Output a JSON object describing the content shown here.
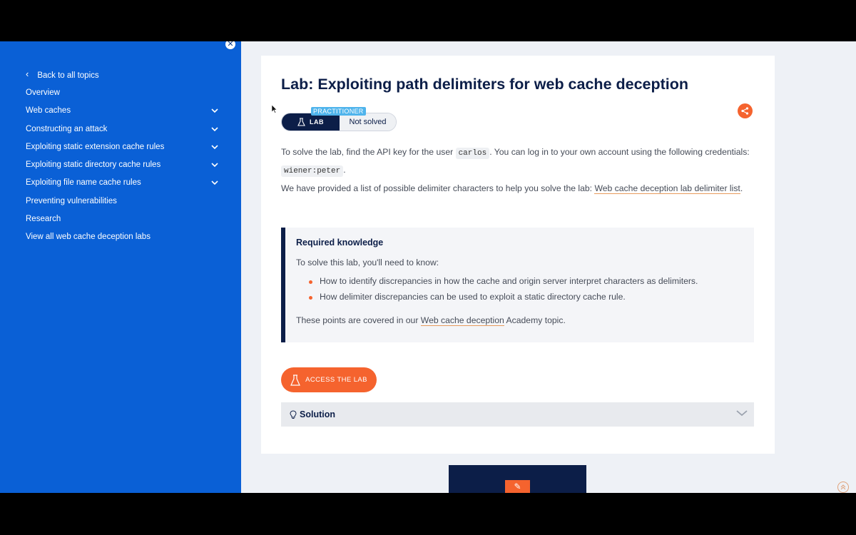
{
  "sidebar": {
    "close_icon": "close-icon",
    "back_label": "Back to all topics",
    "items": [
      {
        "label": "Overview",
        "expandable": false
      },
      {
        "label": "Web caches",
        "expandable": true
      },
      {
        "label": "Constructing an attack",
        "expandable": true
      },
      {
        "label": "Exploiting static extension cache rules",
        "expandable": true
      },
      {
        "label": "Exploiting static directory cache rules",
        "expandable": true
      },
      {
        "label": "Exploiting file name cache rules",
        "expandable": true
      },
      {
        "label": "Preventing vulnerabilities",
        "expandable": false
      },
      {
        "label": "Research",
        "expandable": false
      },
      {
        "label": "View all web cache deception labs",
        "expandable": false
      }
    ]
  },
  "lab": {
    "title": "Lab: Exploiting path delimiters for web cache deception",
    "level": "PRACTITIONER",
    "badge_label": "LAB",
    "status": "Not solved",
    "p1_a": "To solve the lab, find the API key for the user ",
    "p1_code1": "carlos",
    "p1_b": ". You can log in to your own account using the following credentials: ",
    "p1_code2": "wiener:peter",
    "p1_c": ".",
    "p2_a": "We have provided a list of possible delimiter characters to help you solve the lab: ",
    "p2_link": "Web cache deception lab delimiter list",
    "p2_b": "."
  },
  "knowledge": {
    "title": "Required knowledge",
    "intro": "To solve this lab, you'll need to know:",
    "points": [
      "How to identify discrepancies in how the cache and origin server interpret characters as delimiters.",
      "How delimiter discrepancies can be used to exploit a static directory cache rule."
    ],
    "outro_a": "These points are covered in our ",
    "outro_link": "Web cache deception",
    "outro_b": " Academy topic."
  },
  "actions": {
    "access_label": "ACCESS THE LAB",
    "solution_label": "Solution"
  },
  "colors": {
    "sidebar": "#0a60d6",
    "accent": "#f5632e",
    "navy": "#0c1e48",
    "practitioner": "#4fb4ec"
  }
}
